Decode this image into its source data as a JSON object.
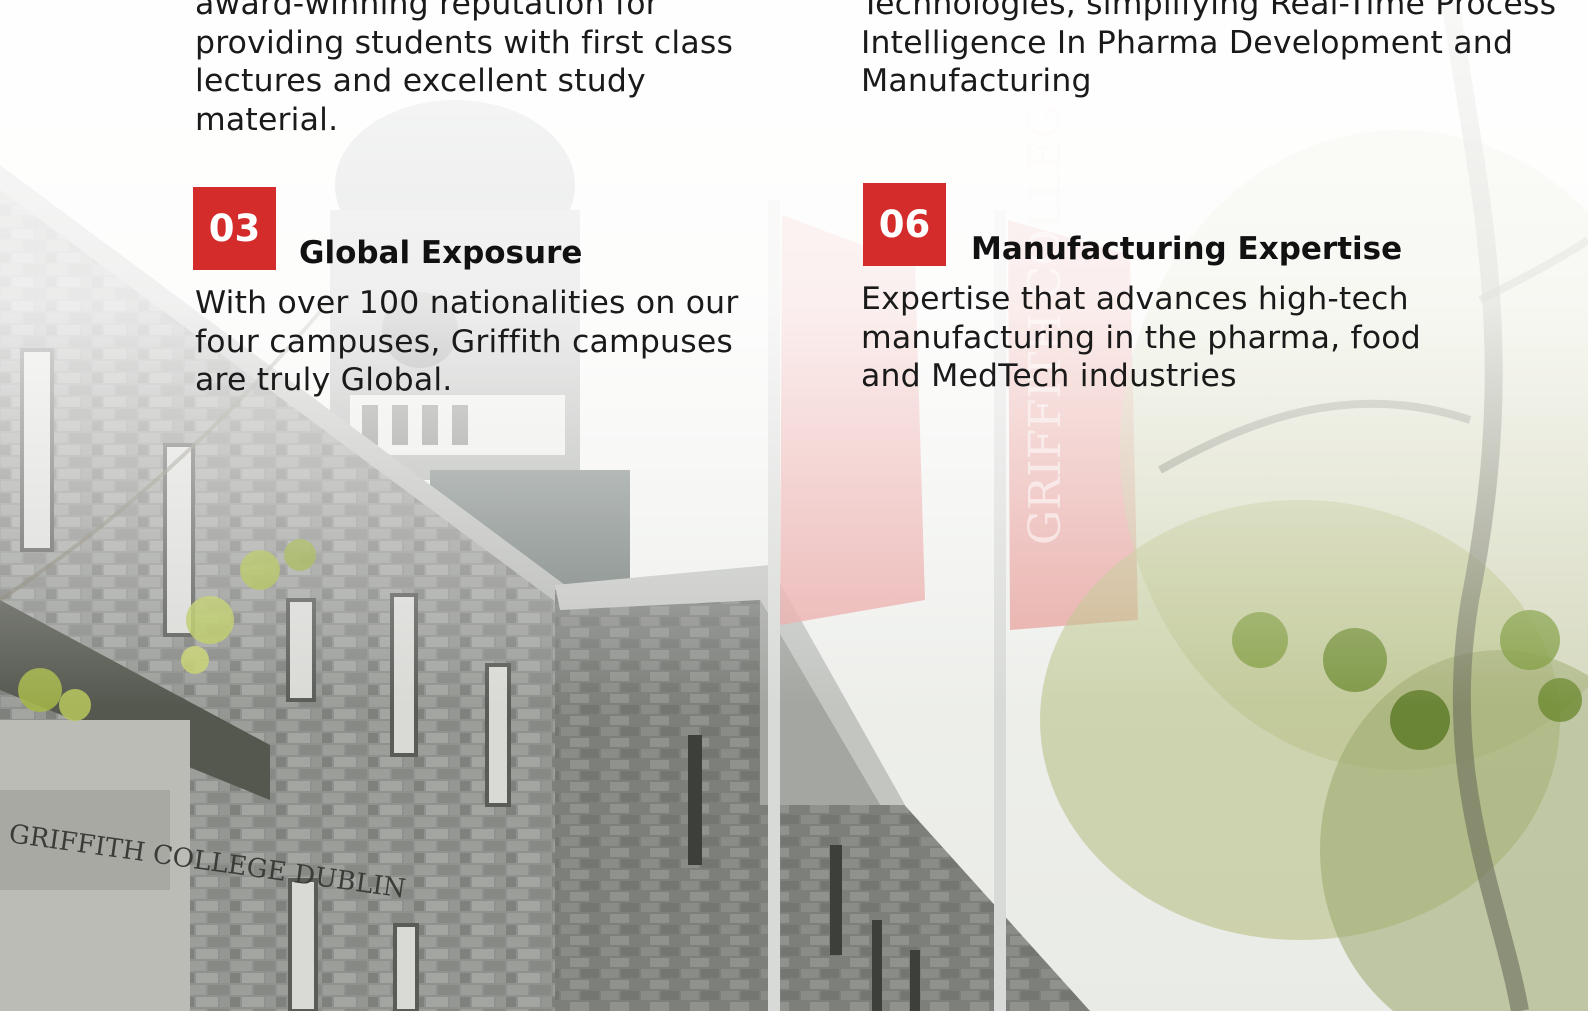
{
  "features": [
    {
      "number": "",
      "heading": "",
      "text": "award-winning reputation for providing students with first class lectures and excellent study material."
    },
    {
      "number": "",
      "heading": "",
      "text": "Technologies, simplifying Real-Time Process Intelligence In Pharma Development and Manufacturing"
    },
    {
      "number": "03",
      "heading": "Global Exposure",
      "text": "With over 100 nationalities on our four campuses, Griffith campuses are truly Global."
    },
    {
      "number": "06",
      "heading": "Manufacturing Expertise",
      "text": "Expertise that advances high-tech manufacturing in the pharma, food and MedTech industries"
    }
  ],
  "photo": {
    "building_sign": "GRIFFITH COLLEGE DUBLIN",
    "flag_text": "GRIFFITH COLLEGE"
  },
  "colors": {
    "accent_red": "#d42b2b",
    "text": "#1a1a1a"
  }
}
